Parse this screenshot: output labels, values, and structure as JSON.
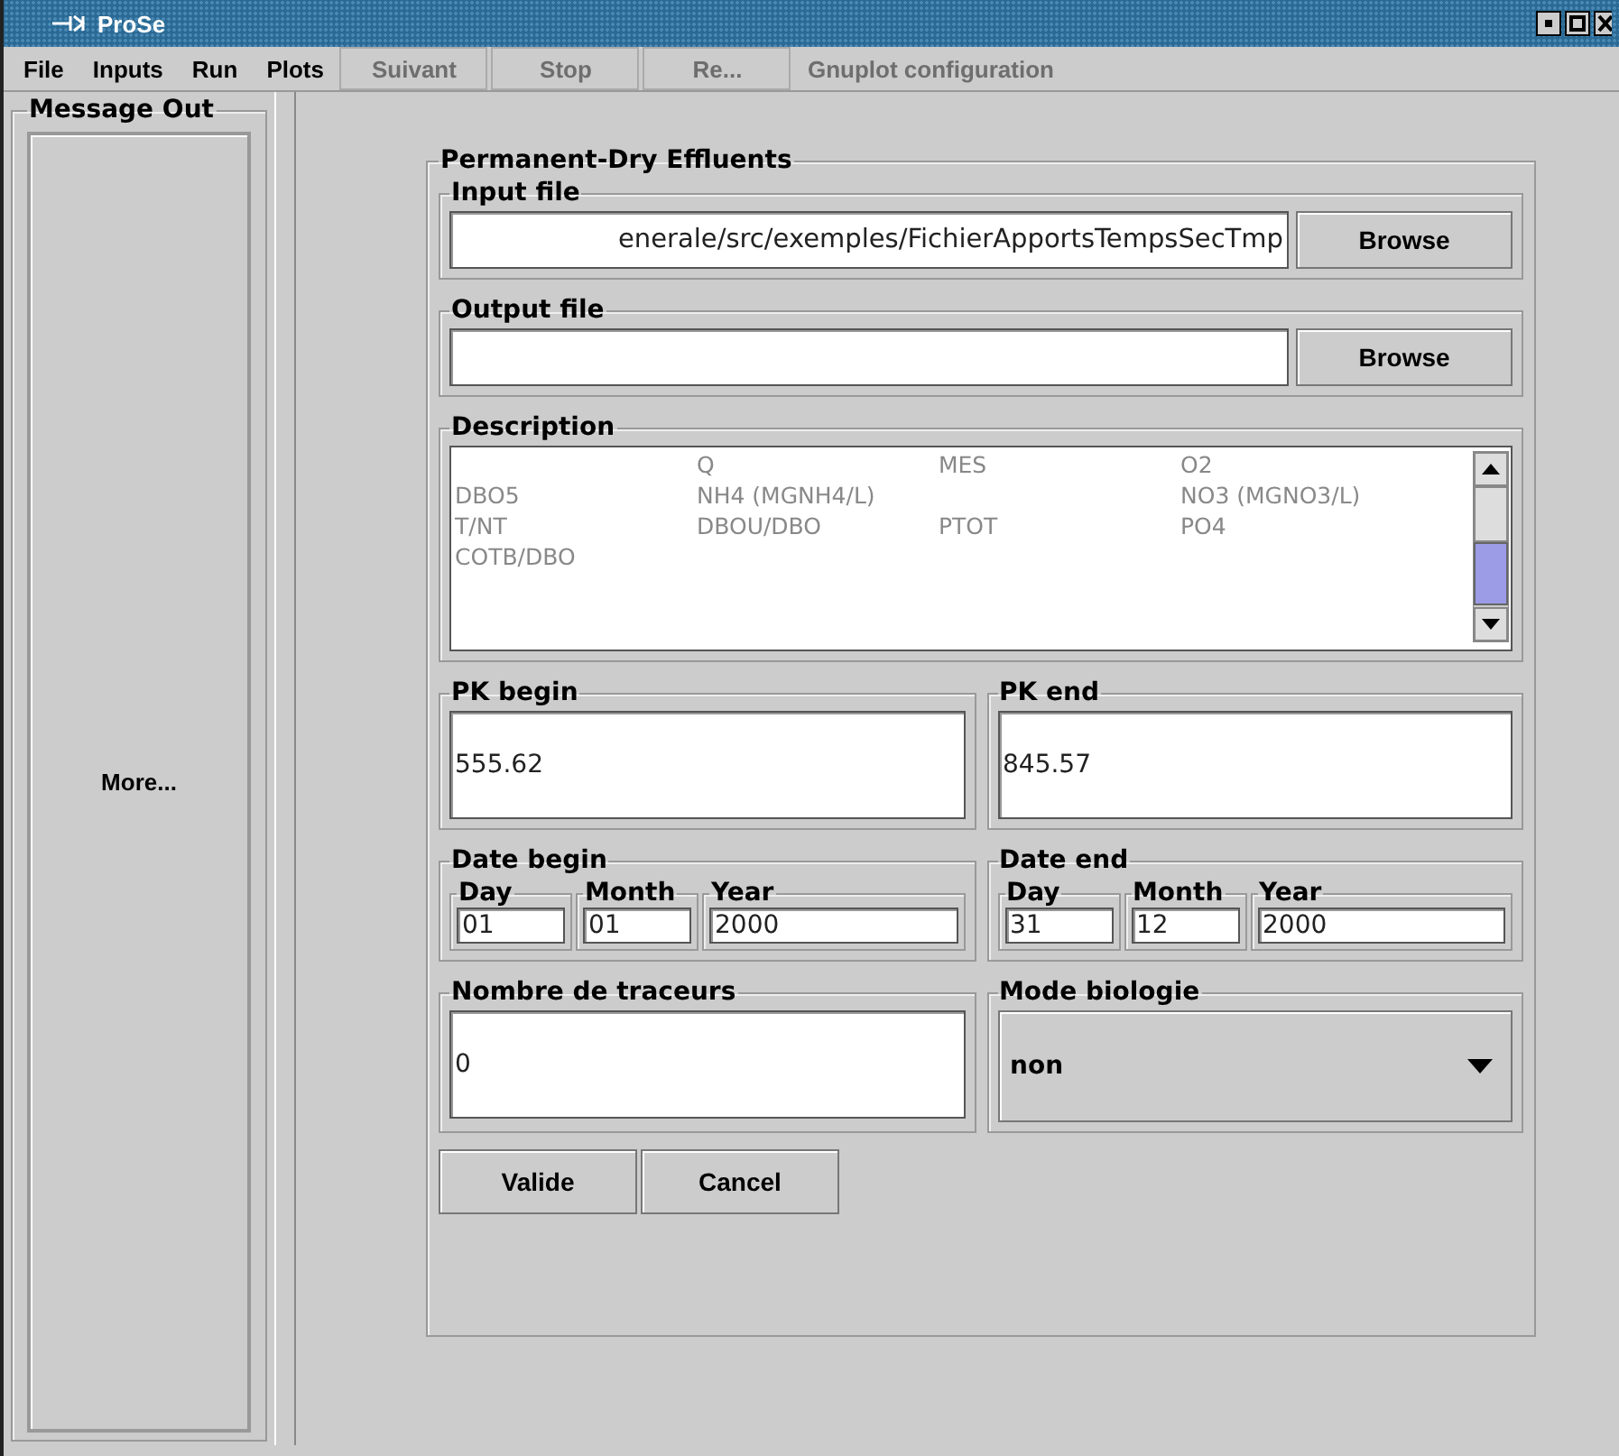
{
  "window": {
    "title": "ProSe"
  },
  "menu": [
    {
      "label": "File",
      "kind": "menu",
      "disabled": false
    },
    {
      "label": "Inputs",
      "kind": "menu",
      "disabled": false
    },
    {
      "label": "Run",
      "kind": "menu",
      "disabled": false
    },
    {
      "label": "Plots",
      "kind": "menu",
      "disabled": false
    },
    {
      "label": "Suivant",
      "kind": "button",
      "disabled": true
    },
    {
      "label": "Stop",
      "kind": "button",
      "disabled": true
    },
    {
      "label": "Re...",
      "kind": "button",
      "disabled": true
    },
    {
      "label": "Gnuplot configuration",
      "kind": "menu",
      "disabled": true
    }
  ],
  "message_panel": {
    "title": "Message Out",
    "button": "More..."
  },
  "form": {
    "title": "Permanent-Dry Effluents",
    "input_file": {
      "label": "Input file",
      "value": "enerale/src/exemples/FichierApportsTempsSecTmp",
      "button": "Browse"
    },
    "output_file": {
      "label": "Output file",
      "button": "Browse"
    },
    "description": {
      "label": "Description",
      "rows": [
        [
          null,
          "Q",
          "MES",
          "O2"
        ],
        [
          "DBO5",
          "NH4 (MGNH4/L)",
          null,
          "NO3 (MGNO3/L)"
        ],
        [
          "T/NT",
          "DBOU/DBO",
          "PTOT",
          "PO4"
        ],
        [
          "COTB/DBO",
          null,
          null,
          null
        ]
      ]
    },
    "pk_begin": {
      "label": "PK begin",
      "value": "555.62"
    },
    "pk_end": {
      "label": "PK end",
      "value": "845.57"
    },
    "dates": [
      {
        "label": "Date begin",
        "fields": [
          {
            "label": "Day",
            "value": "01"
          },
          {
            "label": "Month",
            "value": "01"
          },
          {
            "label": "Year",
            "value": "2000"
          }
        ]
      },
      {
        "label": "Date end",
        "fields": [
          {
            "label": "Day",
            "value": "31"
          },
          {
            "label": "Month",
            "value": "12"
          },
          {
            "label": "Year",
            "value": "2000"
          }
        ]
      }
    ],
    "tracers": {
      "label": "Nombre de traceurs",
      "value": "0"
    },
    "biology": {
      "label": "Mode biologie",
      "value": "non"
    },
    "buttons": [
      "Valide",
      "Cancel"
    ]
  }
}
